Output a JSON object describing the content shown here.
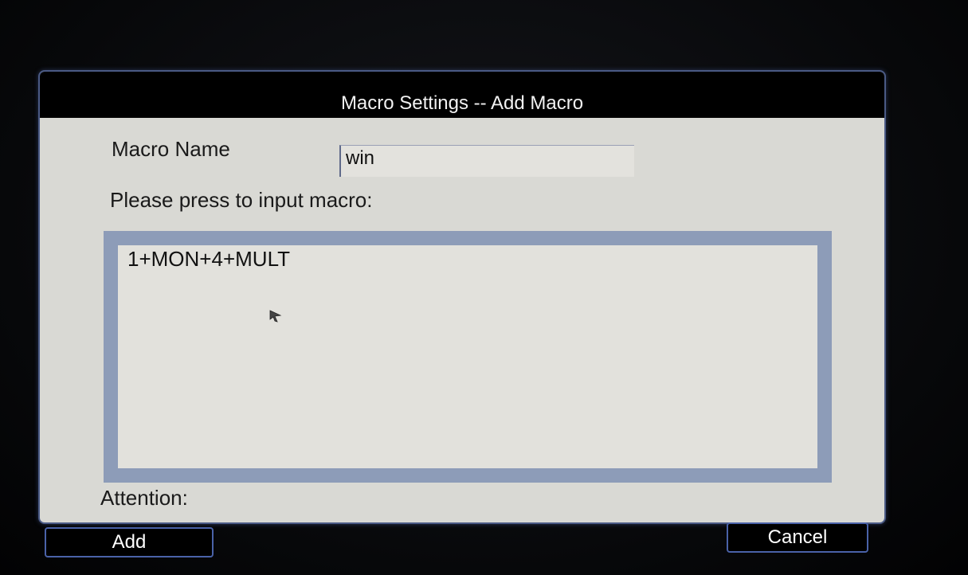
{
  "dialog": {
    "title": "Macro Settings -- Add Macro",
    "macro_name_label": "Macro Name",
    "macro_name_value": "win",
    "prompt_label": "Please press to input macro:",
    "macro_sequence": "1+MON+4+MULT",
    "attention_label": "Attention:"
  },
  "buttons": {
    "add_label": "Add",
    "cancel_label": "Cancel"
  },
  "colors": {
    "accent_border": "#4a62a8",
    "panel_bg": "#d9d9d4",
    "macro_frame": "#8d9cb8"
  },
  "icons": {
    "cursor": "mouse-pointer-icon"
  }
}
